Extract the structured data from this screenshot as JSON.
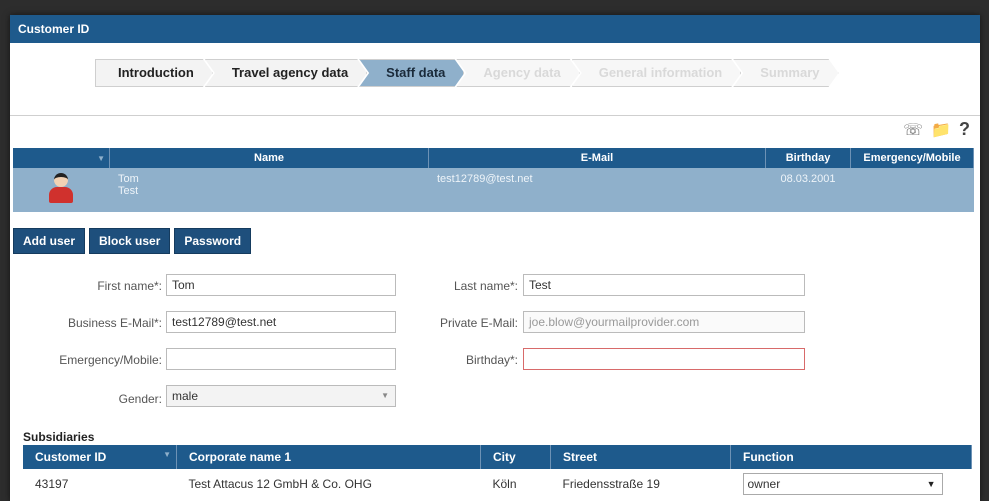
{
  "dialog": {
    "title": "Customer ID"
  },
  "wizard": {
    "steps": [
      {
        "label": "Introduction",
        "state": "done"
      },
      {
        "label": "Travel agency data",
        "state": "done"
      },
      {
        "label": "Staff data",
        "state": "active"
      },
      {
        "label": "Agency data",
        "state": "disabled"
      },
      {
        "label": "General information",
        "state": "disabled"
      },
      {
        "label": "Summary",
        "state": "disabled"
      }
    ]
  },
  "toolbar": {
    "icons": [
      "phone-icon",
      "folder-icon",
      "help-icon"
    ],
    "help_glyph": "?"
  },
  "staff_table": {
    "columns": [
      "",
      "Name",
      "E-Mail",
      "Birthday",
      "Emergency/Mobile"
    ],
    "rows": [
      {
        "first": "Tom",
        "last": "Test",
        "email": "test12789@test.net",
        "birthday": "08.03.2001",
        "mobile": ""
      }
    ]
  },
  "buttons": {
    "add_user": "Add user",
    "block_user": "Block user",
    "password": "Password"
  },
  "form": {
    "first_name": {
      "label": "First name*:",
      "value": "Tom"
    },
    "last_name": {
      "label": "Last name*:",
      "value": "Test"
    },
    "business_email": {
      "label": "Business E-Mail*:",
      "value": "test12789@test.net"
    },
    "private_email": {
      "label": "Private E-Mail:",
      "value": "",
      "placeholder": "joe.blow@yourmailprovider.com"
    },
    "emergency_mobile": {
      "label": "Emergency/Mobile:",
      "value": ""
    },
    "birthday": {
      "label": "Birthday*:",
      "value": ""
    },
    "gender": {
      "label": "Gender:",
      "value": "male"
    }
  },
  "subsidiaries": {
    "title": "Subsidiaries",
    "columns": [
      "Customer ID",
      "Corporate name 1",
      "City",
      "Street",
      "Function"
    ],
    "rows": [
      {
        "customer_id": "43197",
        "corporate_name": "Test Attacus 12 GmbH & Co. OHG",
        "city": "Köln",
        "street": "Friedensstraße 19",
        "function": "owner"
      }
    ]
  },
  "colors": {
    "header": "#1e5a8c",
    "selected_row": "#8fb0cb",
    "error_border": "#d86a6a"
  }
}
